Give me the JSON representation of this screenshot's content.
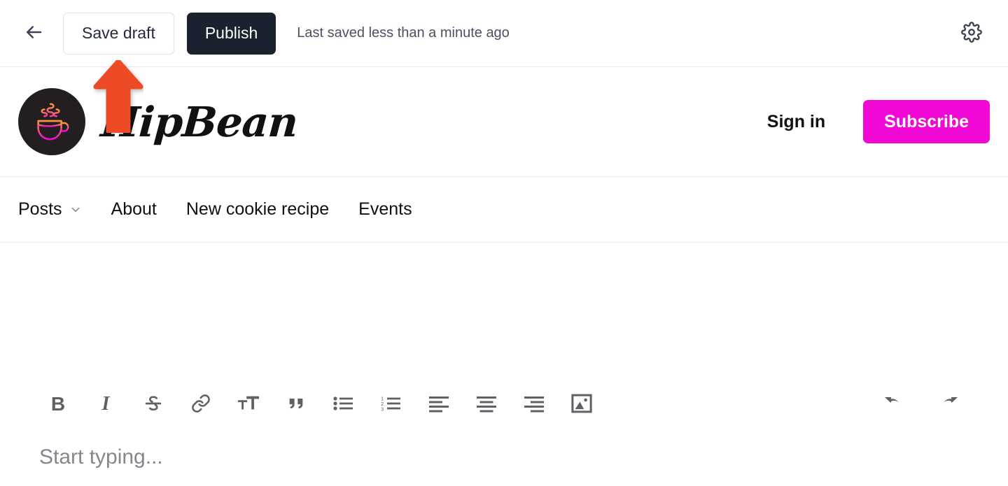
{
  "editor_bar": {
    "back_icon": "arrow-left-icon",
    "save_draft_label": "Save draft",
    "publish_label": "Publish",
    "saved_status": "Last saved less than a minute ago",
    "settings_icon": "gear-icon"
  },
  "site_header": {
    "logo_icon": "coffee-cup-icon",
    "brand_name": "HipBean",
    "signin_label": "Sign in",
    "subscribe_label": "Subscribe",
    "subscribe_color": "#f108d4",
    "logo_bg_color": "#231f20",
    "logo_gradient_from": "#f79439",
    "logo_gradient_to": "#f108d4"
  },
  "site_nav": {
    "items": [
      {
        "label": "Posts",
        "has_dropdown": true,
        "icon": "chevron-down-icon"
      },
      {
        "label": "About",
        "has_dropdown": false
      },
      {
        "label": "New cookie recipe",
        "has_dropdown": false
      },
      {
        "label": "Events",
        "has_dropdown": false
      }
    ]
  },
  "editor": {
    "placeholder": "Start typing...",
    "toolbar": [
      {
        "name": "bold-button",
        "icon": "bold-icon",
        "glyph": "B"
      },
      {
        "name": "italic-button",
        "icon": "italic-icon",
        "glyph": "I"
      },
      {
        "name": "strikethrough-button",
        "icon": "strikethrough-icon"
      },
      {
        "name": "link-button",
        "icon": "link-icon"
      },
      {
        "name": "text-size-button",
        "icon": "text-size-icon"
      },
      {
        "name": "blockquote-button",
        "icon": "quote-icon"
      },
      {
        "name": "bulleted-list-button",
        "icon": "bulleted-list-icon"
      },
      {
        "name": "numbered-list-button",
        "icon": "numbered-list-icon"
      },
      {
        "name": "align-left-button",
        "icon": "align-left-icon"
      },
      {
        "name": "align-center-button",
        "icon": "align-center-icon"
      },
      {
        "name": "align-right-button",
        "icon": "align-right-icon"
      },
      {
        "name": "insert-image-button",
        "icon": "image-icon"
      },
      {
        "name": "undo-button",
        "icon": "undo-icon"
      },
      {
        "name": "redo-button",
        "icon": "redo-icon"
      }
    ]
  },
  "annotation": {
    "arrow_color": "#ed4b28",
    "points_to": "Save draft"
  }
}
